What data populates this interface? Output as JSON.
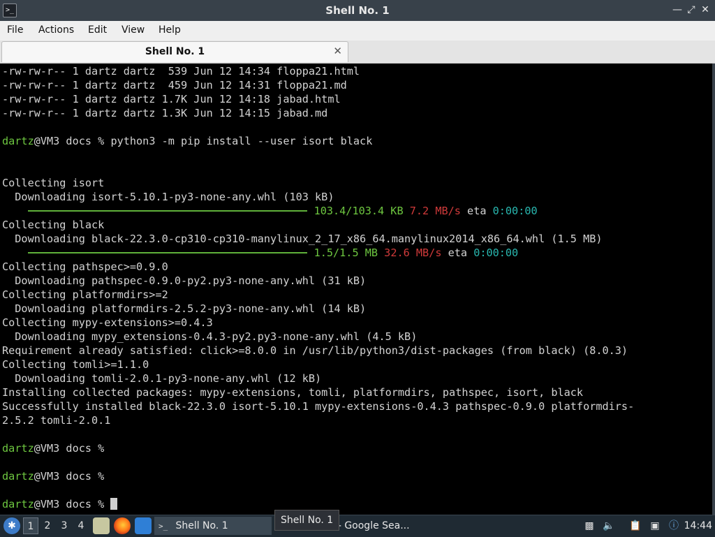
{
  "window": {
    "title": "Shell No. 1",
    "icon": "terminal-icon",
    "controls": [
      "minimize-icon",
      "restore-icon",
      "close-icon"
    ]
  },
  "menubar": {
    "items": [
      "File",
      "Actions",
      "Edit",
      "View",
      "Help"
    ]
  },
  "tabs": [
    {
      "label": "Shell No. 1",
      "active": true
    }
  ],
  "terminal": {
    "colors": {
      "bg": "#000000",
      "fg": "#d3d3d3",
      "user": "#6ec740",
      "progress": "#6ec740",
      "speed": "#d03a3a",
      "eta": "#29b8b0"
    },
    "ls_lines": [
      "-rw-rw-r-- 1 dartz dartz  539 Jun 12 14:34 floppa21.html",
      "-rw-rw-r-- 1 dartz dartz  459 Jun 12 14:31 floppa21.md",
      "-rw-rw-r-- 1 dartz dartz 1.7K Jun 12 14:18 jabad.html",
      "-rw-rw-r-- 1 dartz dartz 1.3K Jun 12 14:15 jabad.md"
    ],
    "prompt": {
      "user": "dartz",
      "rest": "@VM3 docs % "
    },
    "command": "python3 -m pip install --user isort black",
    "out": {
      "l1": "Collecting isort",
      "l2": "  Downloading isort-5.10.1-py3-none-any.whl (103 kB)",
      "p1": {
        "size": "103.4/103.4 KB",
        "speed": "7.2 MB/s",
        "eta_label": " eta ",
        "eta": "0:00:00",
        "fraction": 1.0
      },
      "l3": "Collecting black",
      "l4": "  Downloading black-22.3.0-cp310-cp310-manylinux_2_17_x86_64.manylinux2014_x86_64.whl (1.5 MB)",
      "p2": {
        "size": "1.5/1.5 MB",
        "speed": "32.6 MB/s",
        "eta_label": " eta ",
        "eta": "0:00:00",
        "fraction": 1.0
      },
      "l5": "Collecting pathspec>=0.9.0",
      "l6": "  Downloading pathspec-0.9.0-py2.py3-none-any.whl (31 kB)",
      "l7": "Collecting platformdirs>=2",
      "l8": "  Downloading platformdirs-2.5.2-py3-none-any.whl (14 kB)",
      "l9": "Collecting mypy-extensions>=0.4.3",
      "l10": "  Downloading mypy_extensions-0.4.3-py2.py3-none-any.whl (4.5 kB)",
      "l11": "Requirement already satisfied: click>=8.0.0 in /usr/lib/python3/dist-packages (from black) (8.0.3)",
      "l12": "Collecting tomli>=1.1.0",
      "l13": "  Downloading tomli-2.0.1-py3-none-any.whl (12 kB)",
      "l14": "Installing collected packages: mypy-extensions, tomli, platformdirs, pathspec, isort, black",
      "l15": "Successfully installed black-22.3.0 isort-5.10.1 mypy-extensions-0.4.3 pathspec-0.9.0 platformdirs-",
      "l16": "2.5.2 tomli-2.0.1"
    }
  },
  "taskbar": {
    "menu_icon": "distro-logo-icon",
    "workspaces": [
      "1",
      "2",
      "3",
      "4"
    ],
    "active_workspace": "1",
    "launchers": [
      "file-manager-icon",
      "firefox-icon",
      "desktop-icon"
    ],
    "tasks": [
      {
        "label": "Shell No. 1",
        "icon": "terminal-icon",
        "active": true
      },
      {
        "label": "ania - Google Sea...",
        "icon": "browser-icon",
        "active": false
      }
    ],
    "tray": [
      "tray-app-icon",
      "volume-icon",
      "clipboard-icon",
      "network-icon"
    ],
    "clock": "14:44",
    "tooltip": "Shell No. 1"
  }
}
